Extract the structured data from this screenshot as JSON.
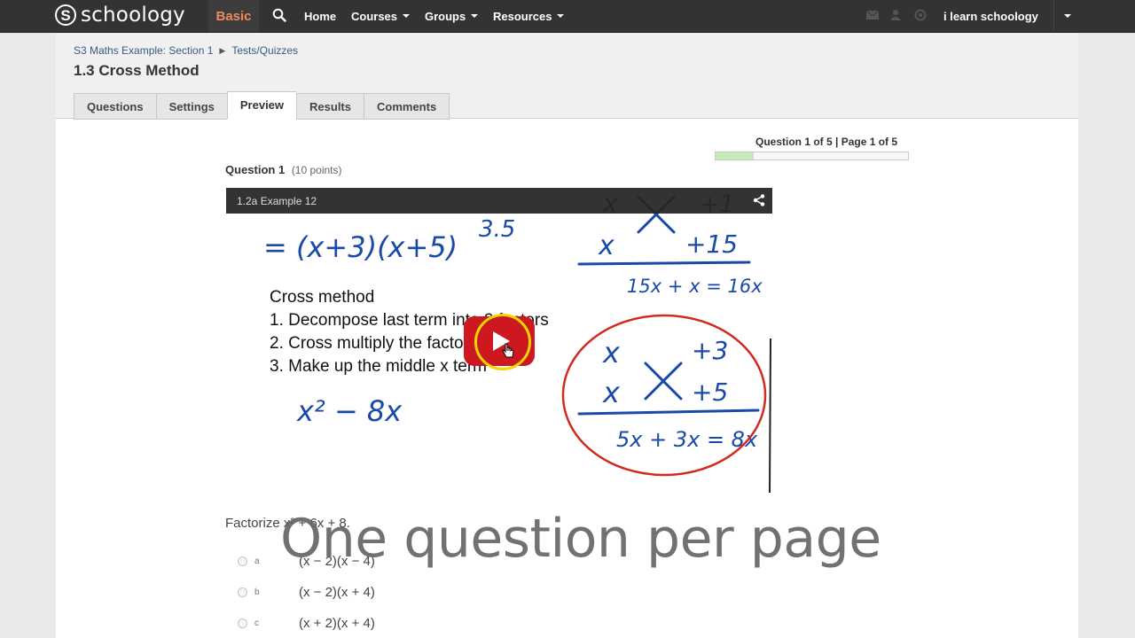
{
  "topbar": {
    "logo_letter": "S",
    "logo_text": "schoology",
    "plan_badge": "Basic",
    "nav": {
      "home": "Home",
      "courses": "Courses",
      "groups": "Groups",
      "resources": "Resources"
    },
    "icons": [
      "messages-icon",
      "requests-icon",
      "notifications-icon"
    ],
    "user_name": "i learn schoology"
  },
  "breadcrumb": {
    "course": "S3 Maths Example: Section 1",
    "section": "Tests/Quizzes"
  },
  "page_title": "1.3 Cross Method",
  "tabs": [
    {
      "label": "Questions"
    },
    {
      "label": "Settings"
    },
    {
      "label": "Preview",
      "active": true
    },
    {
      "label": "Results"
    },
    {
      "label": "Comments"
    }
  ],
  "progress": {
    "label": "Question 1 of 5 | Page 1 of 5",
    "fraction": 0.2
  },
  "question": {
    "title": "Question 1",
    "points": "(10 points)",
    "text": "Factorize x² + 6x + 8.",
    "answers": [
      {
        "letter": "a",
        "text": "(x − 2)(x − 4)"
      },
      {
        "letter": "b",
        "text": "(x − 2)(x + 4)"
      },
      {
        "letter": "c",
        "text": "(x + 2)(x + 4)"
      }
    ]
  },
  "video": {
    "title": "1.2a Example 12",
    "slide_lines": [
      "Cross method",
      "1. Decompose last term into 2 factors",
      "2. Cross multiply the factors",
      "3. Make up the middle x term"
    ],
    "handwriting": {
      "top_eq": "= (x+3)(x+5)",
      "top_num": "3.5",
      "cross_top_a": "x",
      "cross_top_b": "+1",
      "cross_bot_a": "x",
      "cross_bot_b": "+15",
      "cross_sum_top": "15x + x = 16x",
      "left_expr": "x² − 8x",
      "circle_a1": "x",
      "circle_b1": "+3",
      "circle_a2": "x",
      "circle_b2": "+5",
      "circle_sum": "5x + 3x = 8x"
    },
    "colors": {
      "ink_blue": "#1a4aa8",
      "ink_red": "#d12b1f",
      "play_red": "#cc181e"
    }
  },
  "overlay_caption": "One question per page"
}
